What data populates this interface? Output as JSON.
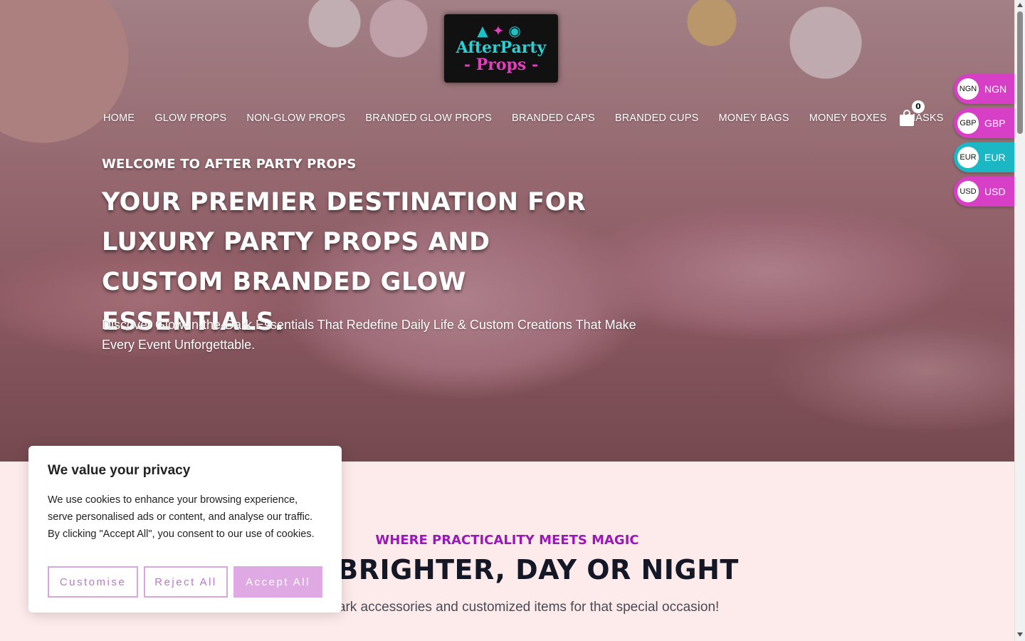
{
  "brand": {
    "logo_line1": "AfterParty",
    "logo_line2": "- Props -",
    "colors": {
      "teal": "#2ad0d3",
      "pink": "#e23fbd",
      "purple": "#9b18b8"
    }
  },
  "nav": {
    "items": [
      "HOME",
      "GLOW PROPS",
      "NON-GLOW PROPS",
      "BRANDED GLOW PROPS",
      "BRANDED CAPS",
      "BRANDED CUPS",
      "MONEY BAGS",
      "MONEY BOXES",
      "MASKS"
    ],
    "cart_count": "0",
    "cart_icon": "shopping-bag-icon"
  },
  "hero": {
    "welcome": "WELCOME TO AFTER PARTY PROPS",
    "headline": "YOUR PREMIER DESTINATION FOR LUXURY PARTY PROPS AND CUSTOM BRANDED GLOW ESSENTIALS.",
    "subtext": "Discover Glow-in-the-Dark Essentials That Redefine Daily Life & Custom Creations That Make Every Event Unforgettable."
  },
  "currency": [
    {
      "badge": "NGN",
      "code": "NGN",
      "color": "#d63fc6"
    },
    {
      "badge": "GBP",
      "code": "GBP",
      "color": "#d63fc6"
    },
    {
      "badge": "EUR",
      "code": "EUR",
      "color": "#1bb7c4"
    },
    {
      "badge": "USD",
      "code": "USD",
      "color": "#d63fc6"
    }
  ],
  "section": {
    "kicker": "WHERE PRACTICALITY MEETS MAGIC",
    "title": "INE BRIGHTER, DAY OR NIGHT",
    "subtitle": "n-the-dark accessories and customized items for that special occasion!"
  },
  "cookie": {
    "title": "We value your privacy",
    "body": "We use cookies to enhance your browsing experience, serve personalised ads or content, and analyse our traffic. By clicking \"Accept All\", you consent to our use of cookies.",
    "customise": "Customise",
    "reject": "Reject All",
    "accept": "Accept All"
  }
}
